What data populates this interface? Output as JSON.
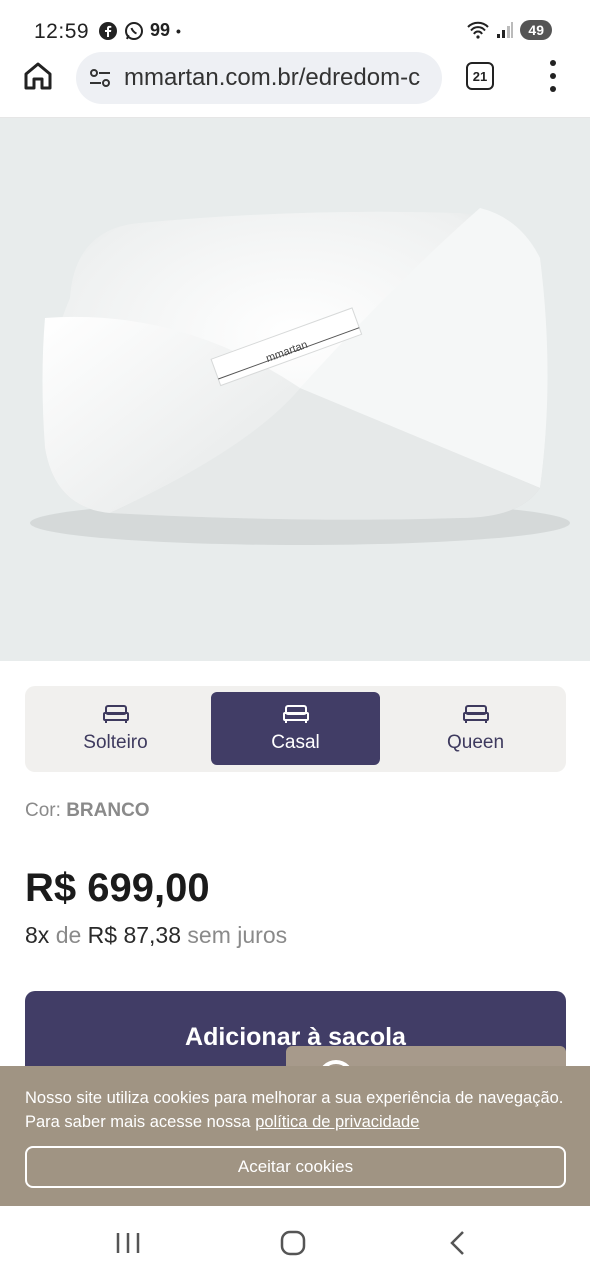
{
  "status_bar": {
    "time": "12:59",
    "notification_count": "99",
    "battery": "49"
  },
  "browser": {
    "url": "mmartan.com.br/edredom-c",
    "tab_count": "21",
    "icons": [
      "home-icon",
      "site-settings-icon",
      "tabs-icon",
      "more-vert-icon"
    ]
  },
  "product": {
    "image_label": "mmartan",
    "sizes": [
      {
        "label": "Solteiro",
        "selected": false
      },
      {
        "label": "Casal",
        "selected": true
      },
      {
        "label": "Queen",
        "selected": false
      }
    ],
    "color_label": "Cor:",
    "color_value": "BRANCO",
    "price": "R$ 699,00",
    "installments": {
      "count": "8x",
      "of": "de",
      "amount": "R$ 87,38",
      "interest": "sem juros"
    },
    "add_to_bag": "Adicionar à sacola"
  },
  "cookie_banner": {
    "text": "Nosso site utiliza cookies para melhorar a sua experiência de navegação. Para saber mais acesse nossa ",
    "link": "política de privacidade",
    "accept": "Aceitar cookies"
  },
  "colors": {
    "brand": "#413d66",
    "cookie_bg": "#a09483",
    "muted": "#8a8a8a"
  }
}
